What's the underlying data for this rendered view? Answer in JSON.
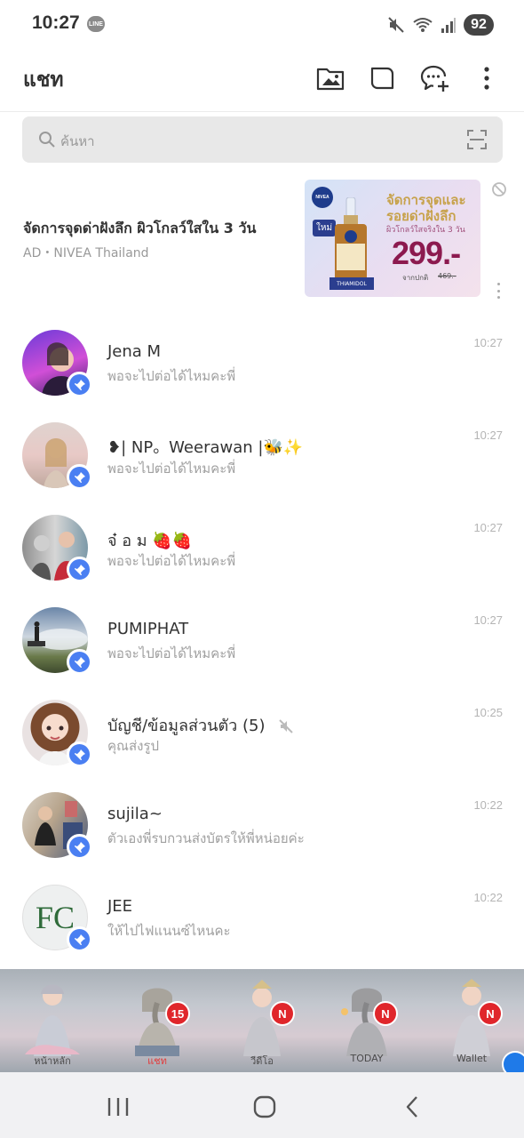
{
  "status_bar": {
    "time": "10:27",
    "app_badge": "LINE",
    "battery": "92",
    "icons": [
      "mute-icon",
      "wifi-icon",
      "signal-icon",
      "battery-icon"
    ]
  },
  "header": {
    "title": "แชท",
    "actions": [
      "album-folder-icon",
      "square-chat-icon",
      "add-chat-icon",
      "more-icon"
    ]
  },
  "search": {
    "placeholder": "ค้นหา"
  },
  "ad": {
    "title": "จัดการจุดด่าฝังลึก ผิวโกลว์ใสใน 3 วัน",
    "sponsor": "AD・NIVEA Thailand",
    "banner": {
      "brand": "NIVEA",
      "badge": "ใหม่",
      "headline_1": "จัดการจุดและ",
      "headline_2": "รอยด่าฝังลึก",
      "subline": "ผิวโกลว์ใสจริงใน 3 วัน",
      "price": "299.-",
      "price_note": "จากปกติ",
      "original_price": "469.-",
      "ingredient": "THIAMIDOL"
    }
  },
  "chats": [
    {
      "name": "Jena M",
      "preview": "พอจะไปต่อได้ไหมคะพี่",
      "time": "10:27",
      "pinned": true,
      "muted": false
    },
    {
      "name": "❥| NP。Weerawan |🐝✨",
      "preview": "พอจะไปต่อได้ไหมคะพี่",
      "time": "10:27",
      "pinned": true,
      "muted": false
    },
    {
      "name": "จ๋ อ ม 🍓🍓",
      "preview": "พอจะไปต่อได้ไหมคะพี่",
      "time": "10:27",
      "pinned": true,
      "muted": false
    },
    {
      "name": "PUMIPHAT",
      "preview": "พอจะไปต่อได้ไหมคะพี่",
      "time": "10:27",
      "pinned": true,
      "muted": false
    },
    {
      "name": "บัญชี/ข้อมูลส่วนตัว (5)",
      "preview": "คุณส่งรูป",
      "time": "10:25",
      "pinned": true,
      "muted": true
    },
    {
      "name": "sujila~",
      "preview": "ตัวเองพี่รบกวนส่งบัตรให้พี่หน่อยค่ะ",
      "time": "10:22",
      "pinned": true,
      "muted": false
    },
    {
      "name": "JEE",
      "preview": "ให้ไปไฟแนนซ์ไหนคะ",
      "time": "10:22",
      "pinned": true,
      "muted": false,
      "avatar_text": "FC"
    }
  ],
  "tabs": [
    {
      "label": "หน้าหลัก",
      "badge": "",
      "active": false
    },
    {
      "label": "แชท",
      "badge": "15",
      "active": true
    },
    {
      "label": "วีดีโอ",
      "badge": "N",
      "active": false
    },
    {
      "label": "TODAY",
      "badge": "N",
      "active": false
    },
    {
      "label": "Wallet",
      "badge": "N",
      "active": false
    }
  ],
  "colors": {
    "pin_badge": "#4a7ff2",
    "tab_badge": "#e0262b",
    "active_tab": "#e23a3a",
    "price": "#8c1a4f"
  },
  "system_nav": [
    "recent-apps-icon",
    "home-icon",
    "back-icon"
  ]
}
